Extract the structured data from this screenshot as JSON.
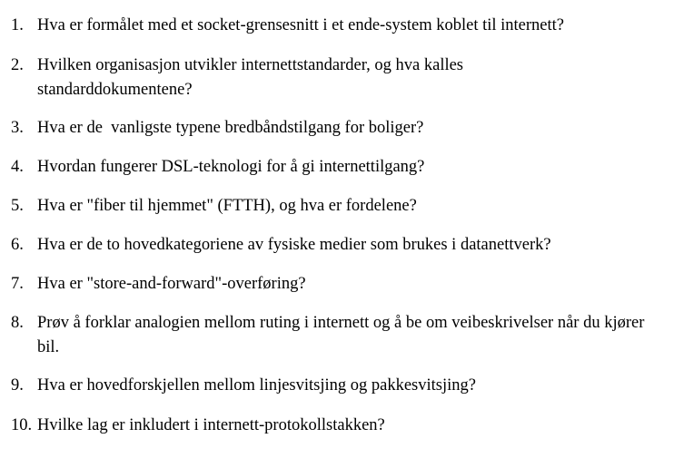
{
  "questions": [
    {
      "number": "1.",
      "text": "Hva er formålet med et socket-grensesnitt i et ende-system koblet til internett?"
    },
    {
      "number": "2.",
      "text": "Hvilken organisasjon utvikler internettstandarder, og hva kalles standarddokumentene?"
    },
    {
      "number": "3.",
      "text": "Hva er de  vanligste typene bredbåndstilgang for boliger?"
    },
    {
      "number": "4.",
      "text": "Hvordan fungerer DSL-teknologi for å gi internettilgang?"
    },
    {
      "number": "5.",
      "text": "Hva er \"fiber til hjemmet\" (FTTH), og hva er fordelene?"
    },
    {
      "number": "6.",
      "text": "Hva er de to hovedkategoriene av fysiske medier som brukes i datanettverk?"
    },
    {
      "number": "7.",
      "text": "Hva er \"store-and-forward\"-overføring?"
    },
    {
      "number": "8.",
      "text": "Prøv å forklar analogien mellom ruting i internett og å be om veibeskrivelser når du kjører bil."
    },
    {
      "number": "9.",
      "text": "Hva er hovedforskjellen mellom linjesvitsjing og pakkesvitsjing?"
    },
    {
      "number": "10.",
      "text": "Hvilke lag er inkludert i internett-protokollstakken?"
    }
  ]
}
